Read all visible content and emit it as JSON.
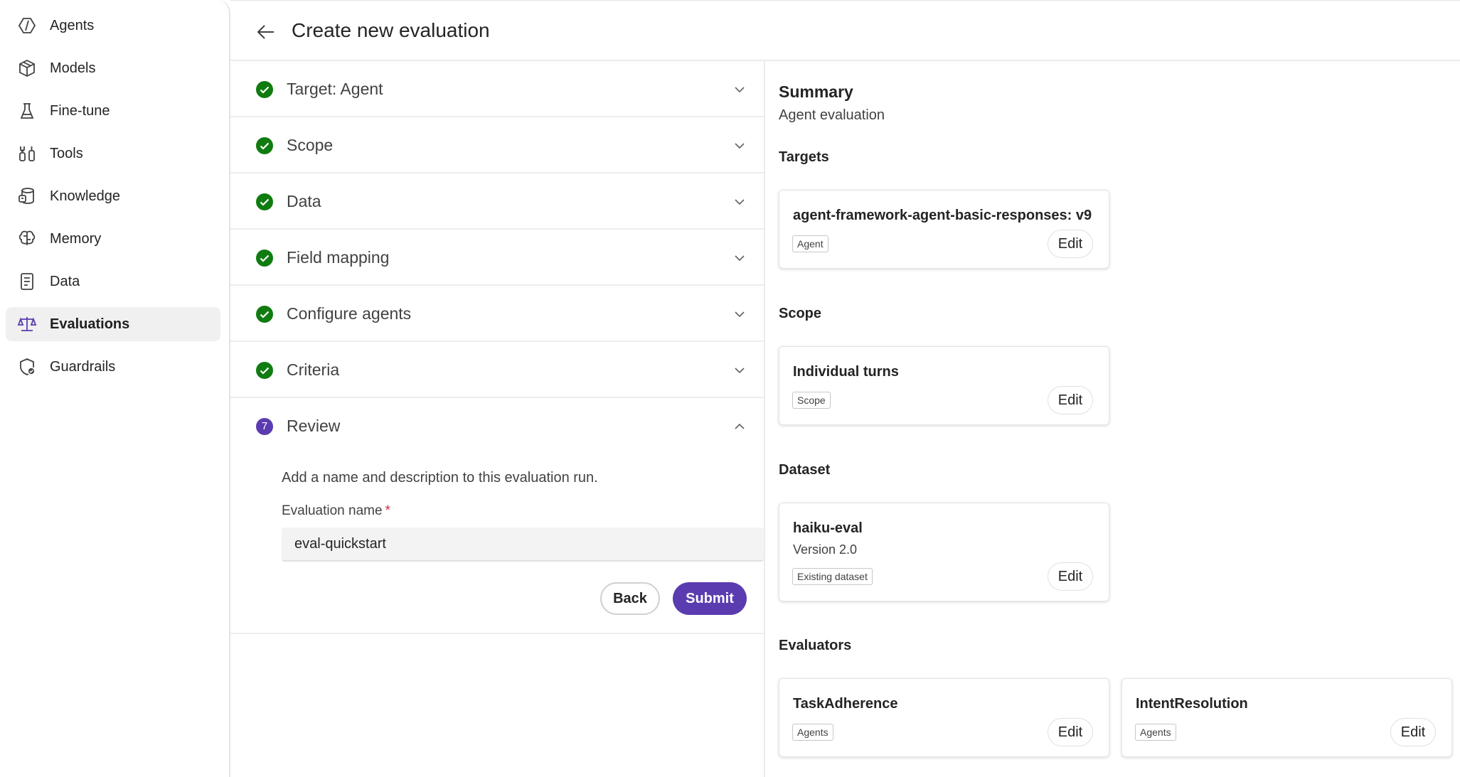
{
  "sidebar": {
    "items": [
      {
        "label": "Agents",
        "icon": "agents-icon"
      },
      {
        "label": "Models",
        "icon": "models-icon"
      },
      {
        "label": "Fine-tune",
        "icon": "fine-tune-icon"
      },
      {
        "label": "Tools",
        "icon": "tools-icon"
      },
      {
        "label": "Knowledge",
        "icon": "knowledge-icon"
      },
      {
        "label": "Memory",
        "icon": "memory-icon"
      },
      {
        "label": "Data",
        "icon": "data-icon"
      },
      {
        "label": "Evaluations",
        "icon": "evaluations-icon",
        "active": true
      },
      {
        "label": "Guardrails",
        "icon": "guardrails-icon"
      }
    ]
  },
  "header": {
    "title": "Create new evaluation"
  },
  "steps": [
    {
      "label": "Target: Agent",
      "status": "complete"
    },
    {
      "label": "Scope",
      "status": "complete"
    },
    {
      "label": "Data",
      "status": "complete"
    },
    {
      "label": "Field mapping",
      "status": "complete"
    },
    {
      "label": "Configure agents",
      "status": "complete"
    },
    {
      "label": "Criteria",
      "status": "complete"
    },
    {
      "label": "Review",
      "status": "current",
      "number": "7"
    }
  ],
  "review": {
    "description": "Add a name and description to this evaluation run.",
    "name_label": "Evaluation name",
    "required_mark": "*",
    "name_value": "eval-quickstart",
    "back_label": "Back",
    "submit_label": "Submit"
  },
  "summary": {
    "title": "Summary",
    "subtitle": "Agent evaluation",
    "edit_label": "Edit",
    "targets": {
      "heading": "Targets",
      "card": {
        "title": "agent-framework-agent-basic-responses: v9",
        "tag": "Agent"
      }
    },
    "scope": {
      "heading": "Scope",
      "card": {
        "title": "Individual turns",
        "tag": "Scope"
      }
    },
    "dataset": {
      "heading": "Dataset",
      "card": {
        "title": "haiku-eval",
        "subtitle": "Version 2.0",
        "tag": "Existing dataset"
      }
    },
    "evaluators": {
      "heading": "Evaluators",
      "cards": [
        {
          "title": "TaskAdherence",
          "tag": "Agents"
        },
        {
          "title": "IntentResolution",
          "tag": "Agents"
        }
      ]
    }
  },
  "colors": {
    "accent": "#5b3cb0",
    "success": "#107c10",
    "required": "#c4314b"
  }
}
